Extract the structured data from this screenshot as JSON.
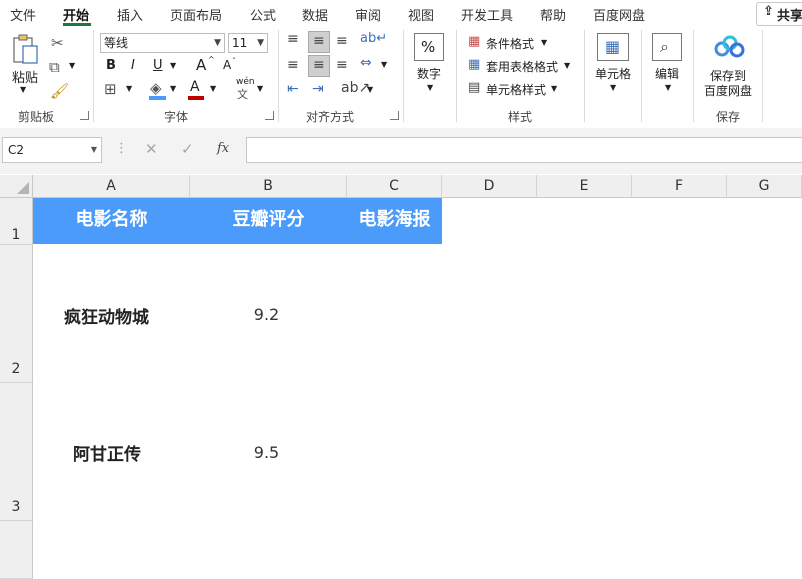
{
  "menu": {
    "items": [
      "文件",
      "开始",
      "插入",
      "页面布局",
      "公式",
      "数据",
      "审阅",
      "视图",
      "开发工具",
      "帮助",
      "百度网盘"
    ],
    "active": "开始",
    "share": "共享"
  },
  "ribbon": {
    "clipboard": {
      "paste": "粘贴",
      "label": "剪贴板"
    },
    "font": {
      "name": "等线",
      "size": "11",
      "label": "字体",
      "bold": "B",
      "italic": "I",
      "underline": "U",
      "grow": "A",
      "shrink": "A",
      "font_color": "A",
      "wen": "wén"
    },
    "alignment": {
      "label": "对齐方式"
    },
    "number": {
      "button": "数字",
      "symbol": "%"
    },
    "styles": {
      "conditional": "条件格式",
      "table": "套用表格格式",
      "cell": "单元格样式",
      "label": "样式"
    },
    "cells": {
      "button": "单元格"
    },
    "editing": {
      "button": "编辑"
    },
    "save": {
      "button_line1": "保存到",
      "button_line2": "百度网盘",
      "label": "保存"
    }
  },
  "formula_bar": {
    "name_box": "C2",
    "cancel": "✕",
    "confirm": "✓",
    "fx": "fx",
    "content": ""
  },
  "sheet": {
    "columns": [
      "A",
      "B",
      "C",
      "D",
      "E",
      "F",
      "G"
    ],
    "rows": [
      "1",
      "2",
      "3"
    ],
    "header_color": "#4b9bfa",
    "headers": [
      "电影名称",
      "豆瓣评分",
      "电影海报"
    ],
    "data": [
      {
        "name": "疯狂动物城",
        "score": "9.2"
      },
      {
        "name": "阿甘正传",
        "score": "9.5"
      }
    ]
  }
}
